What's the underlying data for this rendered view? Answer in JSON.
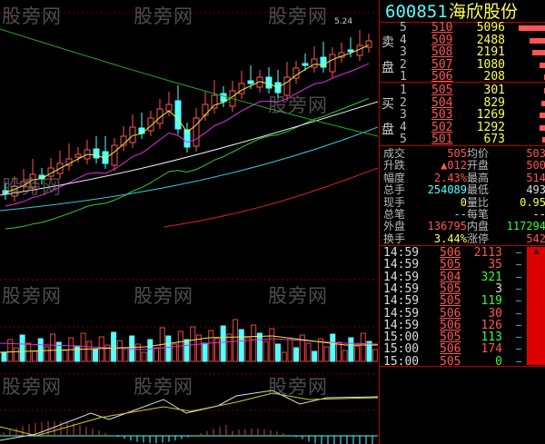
{
  "watermark": "股旁网",
  "chart": {
    "high_label": "5.24"
  },
  "quote": {
    "code": "600851",
    "name": "海欣股份"
  },
  "asks": [
    {
      "level": "5",
      "price": "510",
      "volume": "5096",
      "depth": 0.9
    },
    {
      "level": "4",
      "price": "509",
      "volume": "2488",
      "depth": 0.55
    },
    {
      "level": "3",
      "price": "508",
      "volume": "2191",
      "depth": 0.45
    },
    {
      "level": "2",
      "price": "507",
      "volume": "1080",
      "depth": 0.2
    },
    {
      "level": "1",
      "price": "506",
      "volume": "208",
      "depth": 0.05
    }
  ],
  "ask_label": [
    "卖",
    "盘"
  ],
  "bids": [
    {
      "level": "1",
      "price": "505",
      "volume": "301",
      "depth": 0.06
    },
    {
      "level": "2",
      "price": "504",
      "volume": "829",
      "depth": 0.15
    },
    {
      "level": "3",
      "price": "503",
      "volume": "1269",
      "depth": 0.22
    },
    {
      "level": "4",
      "price": "502",
      "volume": "1292",
      "depth": 0.22
    },
    {
      "level": "5",
      "price": "501",
      "volume": "673",
      "depth": 0.12
    }
  ],
  "bid_label": [
    "买",
    "盘"
  ],
  "stats": [
    {
      "l1": "成交",
      "v1": "505",
      "l2": "均价",
      "v2": "503",
      "c1": "red",
      "c2": "red"
    },
    {
      "l1": "升跌",
      "v1": "▲012",
      "l2": "开盘",
      "v2": "500",
      "c1": "red",
      "c2": "red"
    },
    {
      "l1": "幅度",
      "v1": "2.43%",
      "l2": "最高",
      "v2": "514",
      "c1": "red",
      "c2": "red"
    },
    {
      "l1": "总手",
      "v1": "254089",
      "l2": "最低",
      "v2": "493",
      "c1": "cy",
      "c2": "wh"
    },
    {
      "l1": "现手",
      "v1": "0",
      "l2": "量比",
      "v2": "0.95",
      "c1": "yel",
      "c2": "yel"
    },
    {
      "l1": "总笔",
      "v1": "--",
      "l2": "每笔",
      "v2": "--",
      "c1": "cy",
      "c2": "yel"
    },
    {
      "l1": "外盘",
      "v1": "136795",
      "l2": "内盘",
      "v2": "117294",
      "c1": "red",
      "c2": "grn"
    },
    {
      "l1": "换手",
      "v1": "3.44%",
      "l2": "涨停",
      "v2": "542",
      "c1": "yel",
      "c2": "red"
    }
  ],
  "ticks": [
    {
      "time": "14:59",
      "price": "506",
      "vol": "2113",
      "c": "red"
    },
    {
      "time": "14:59",
      "price": "505",
      "vol": "35",
      "c": "red"
    },
    {
      "time": "14:59",
      "price": "504",
      "vol": "321",
      "c": "grn"
    },
    {
      "time": "14:59",
      "price": "505",
      "vol": "3",
      "c": "wh"
    },
    {
      "time": "14:59",
      "price": "505",
      "vol": "119",
      "c": "grn"
    },
    {
      "time": "14:59",
      "price": "506",
      "vol": "30",
      "c": "red"
    },
    {
      "time": "14:59",
      "price": "506",
      "vol": "126",
      "c": "red"
    },
    {
      "time": "15:00",
      "price": "505",
      "vol": "113",
      "c": "grn"
    },
    {
      "time": "15:00",
      "price": "506",
      "vol": "174",
      "c": "red"
    },
    {
      "time": "15:00",
      "price": "505",
      "vol": "0",
      "c": "grn"
    }
  ]
}
